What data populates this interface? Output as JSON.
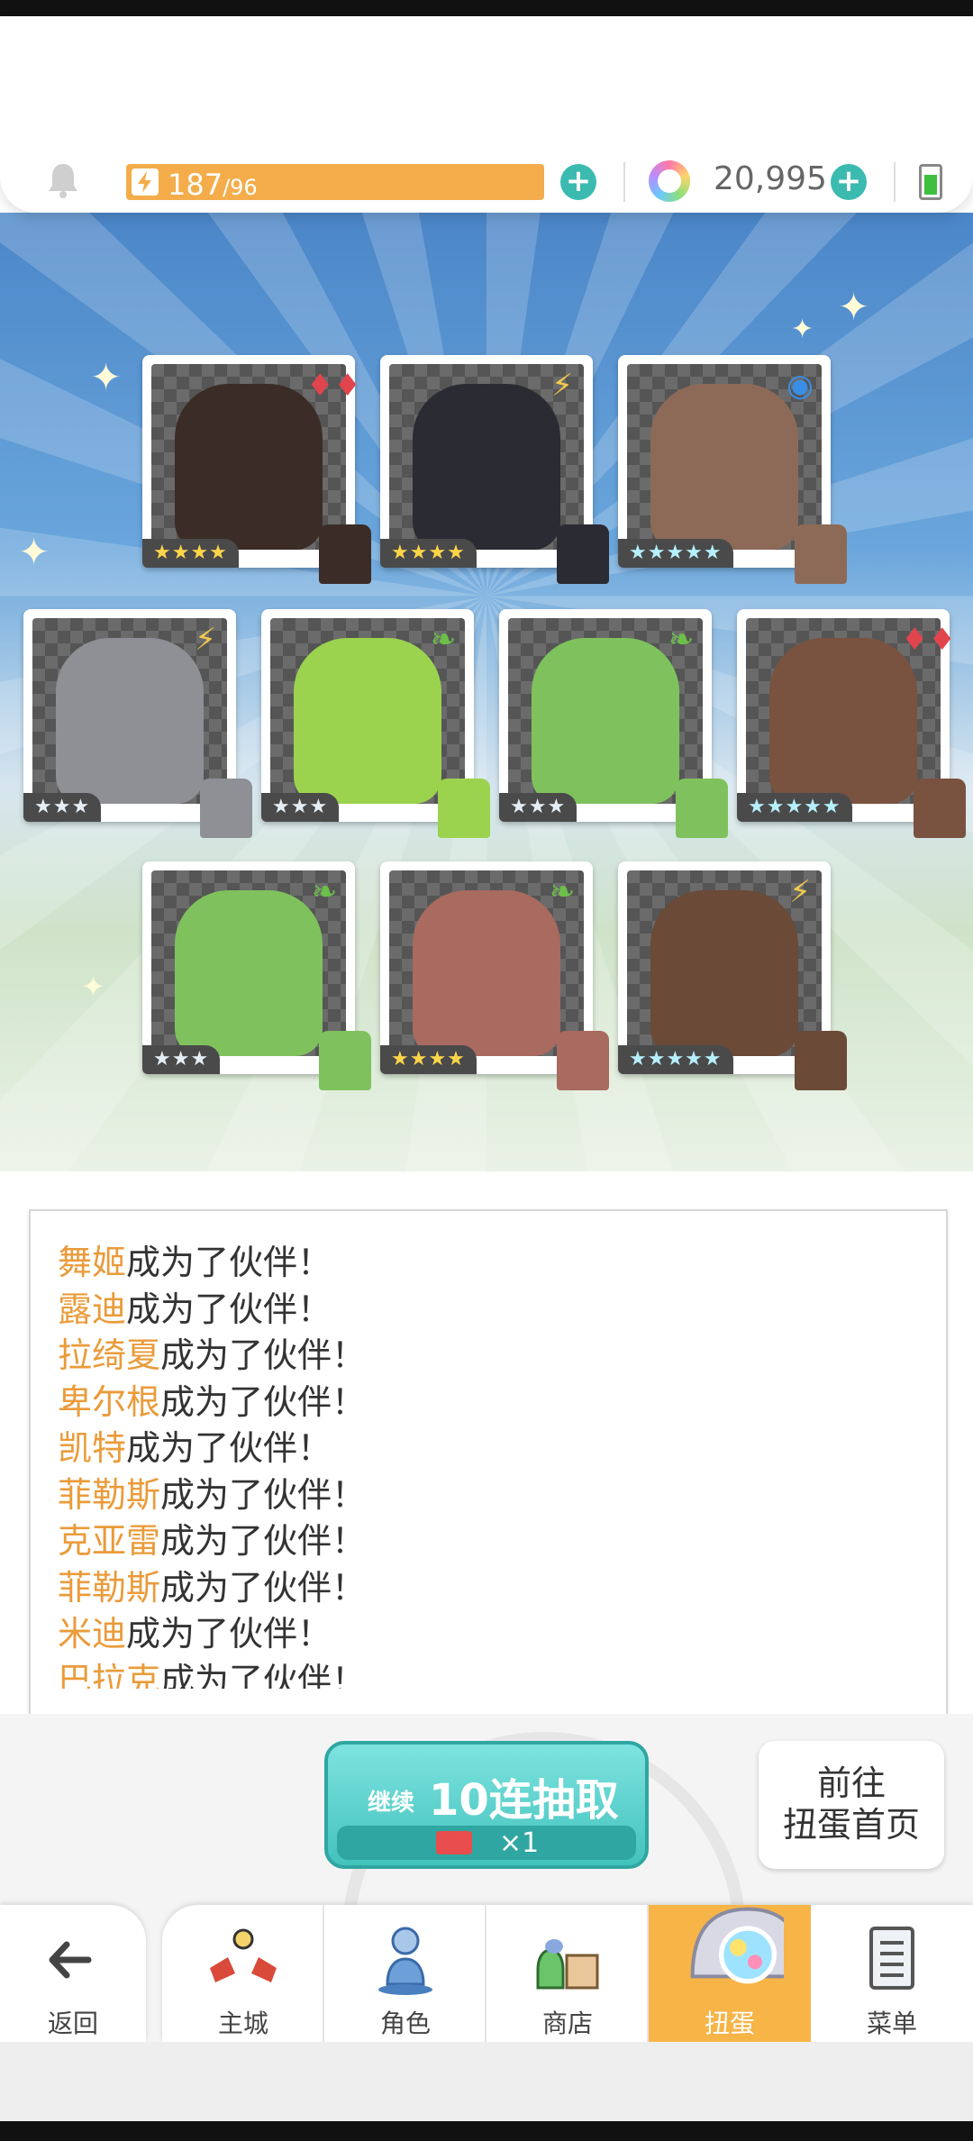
{
  "status": {
    "energy_current": "187",
    "energy_max": "/96",
    "gems": "20,995"
  },
  "cards": [
    {
      "name": "舞姬",
      "element": "diamond",
      "stars": "★★★★",
      "tier": "gold",
      "color": "#3b2c27"
    },
    {
      "name": "露迪",
      "element": "bolt",
      "stars": "★★★★",
      "tier": "gold",
      "color": "#2b2b33"
    },
    {
      "name": "拉绮夏",
      "element": "water",
      "stars": "★★★★★",
      "tier": "rainbow",
      "color": "#8d6a57"
    },
    {
      "name": "卑尔根",
      "element": "bolt",
      "stars": "★★★",
      "tier": "silver",
      "color": "#8e9096"
    },
    {
      "name": "凯特",
      "element": "leaf",
      "stars": "★★★",
      "tier": "silver",
      "color": "#9bd34e"
    },
    {
      "name": "菲勒斯",
      "element": "leaf",
      "stars": "★★★",
      "tier": "silver",
      "color": "#7fc25d"
    },
    {
      "name": "克亚雷",
      "element": "diamond",
      "stars": "★★★★★",
      "tier": "rainbow",
      "color": "#7a5240"
    },
    {
      "name": "菲勒斯",
      "element": "leaf",
      "stars": "★★★",
      "tier": "silver",
      "color": "#7fc25d"
    },
    {
      "name": "米迪",
      "element": "leaf",
      "stars": "★★★★",
      "tier": "gold",
      "color": "#a96a5f"
    },
    {
      "name": "巴拉克",
      "element": "bolt",
      "stars": "★★★★★",
      "tier": "rainbow",
      "color": "#6b4a37"
    }
  ],
  "log": {
    "suffix": "成为了伙伴！",
    "names": [
      "舞姬",
      "露迪",
      "拉绮夏",
      "卑尔根",
      "凯特",
      "菲勒斯",
      "克亚雷",
      "菲勒斯",
      "米迪",
      "巴拉克"
    ]
  },
  "draw_button": {
    "continue_label": "继续",
    "main_label": "10连抽取",
    "cost": "×1"
  },
  "goto_button": {
    "line1": "前往",
    "line2": "扭蛋首页"
  },
  "nav": {
    "back": "返回",
    "items": [
      {
        "label": "主城",
        "icon": "castle-icon"
      },
      {
        "label": "角色",
        "icon": "character-icon"
      },
      {
        "label": "商店",
        "icon": "shop-icon"
      },
      {
        "label": "扭蛋",
        "icon": "gacha-icon"
      },
      {
        "label": "菜单",
        "icon": "menu-icon"
      }
    ],
    "active_index": 3
  },
  "colors": {
    "accent_orange": "#f4ad4a",
    "teal": "#3bbab0",
    "name_orange": "#ea9b3a"
  }
}
